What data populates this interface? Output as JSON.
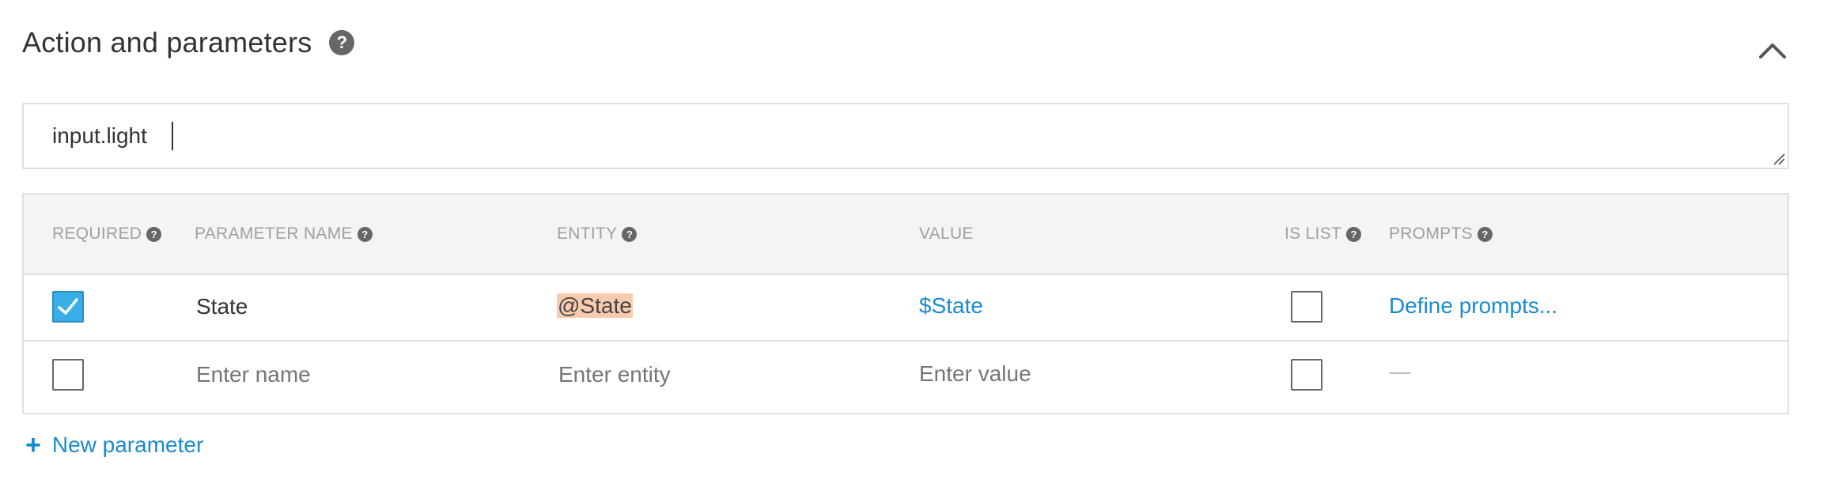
{
  "section": {
    "title": "Action and parameters",
    "help_glyph": "?"
  },
  "action": {
    "value": "input.light"
  },
  "table": {
    "headers": {
      "required": "REQUIRED",
      "parameter_name": "PARAMETER NAME",
      "entity": "ENTITY",
      "value": "VALUE",
      "is_list": "IS LIST",
      "prompts": "PROMPTS"
    },
    "help_glyph": "?",
    "rows": [
      {
        "required": true,
        "name": "State",
        "entity": "@State",
        "value": "$State",
        "is_list": false,
        "prompts": "Define prompts..."
      }
    ],
    "new_row": {
      "required": false,
      "name_placeholder": "Enter name",
      "entity_placeholder": "Enter entity",
      "value_placeholder": "Enter value",
      "is_list": false,
      "prompts": "—"
    }
  },
  "new_parameter": {
    "plus": "+",
    "label": "New parameter"
  },
  "colors": {
    "accent": "#1a8bd0",
    "checkbox_checked": "#3aaee8",
    "entity_highlight": "#f8cbad",
    "header_bg": "#f3f4f3"
  },
  "icons": {
    "help": "help-circle-icon",
    "collapse": "chevron-up-icon",
    "check": "check-icon",
    "add": "plus-icon",
    "resize": "resize-handle-icon"
  }
}
